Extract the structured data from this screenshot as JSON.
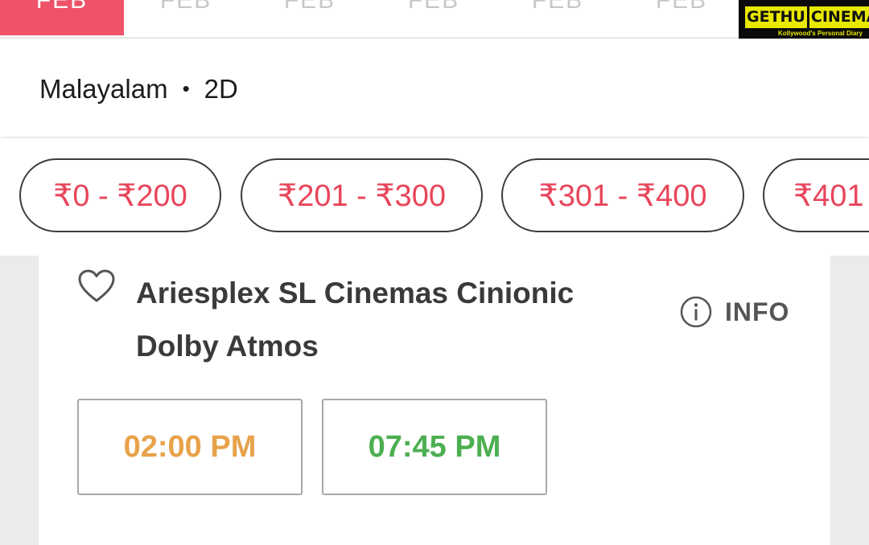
{
  "date_tabs": [
    {
      "label": "FEB",
      "active": true
    },
    {
      "label": "FEB",
      "active": false
    },
    {
      "label": "FEB",
      "active": false
    },
    {
      "label": "FEB",
      "active": false
    },
    {
      "label": "FEB",
      "active": false
    },
    {
      "label": "FEB",
      "active": false
    }
  ],
  "watermark": {
    "name_part1": "GETHU",
    "name_part2": "CINEMA",
    "tagline": "Kollywood's Personal Diary"
  },
  "language_row": {
    "language": "Malayalam",
    "separator": "•",
    "format": "2D"
  },
  "price_filters": [
    {
      "label": "₹0 - ₹200"
    },
    {
      "label": "₹201 - ₹300"
    },
    {
      "label": "₹301 - ₹400"
    },
    {
      "label": "₹401"
    }
  ],
  "cinema": {
    "name_line1": "Ariesplex SL Cinemas Cinionic",
    "name_line2": "Dolby Atmos",
    "info_label": "INFO",
    "showtimes": [
      {
        "time": "02:00 PM",
        "color": "#e8a24a"
      },
      {
        "time": "07:45 PM",
        "color": "#4caf50"
      }
    ]
  },
  "colors": {
    "accent": "#ef5369",
    "price_text": "#e8455a",
    "fast_filling": "#e8a24a",
    "available": "#4caf50"
  }
}
